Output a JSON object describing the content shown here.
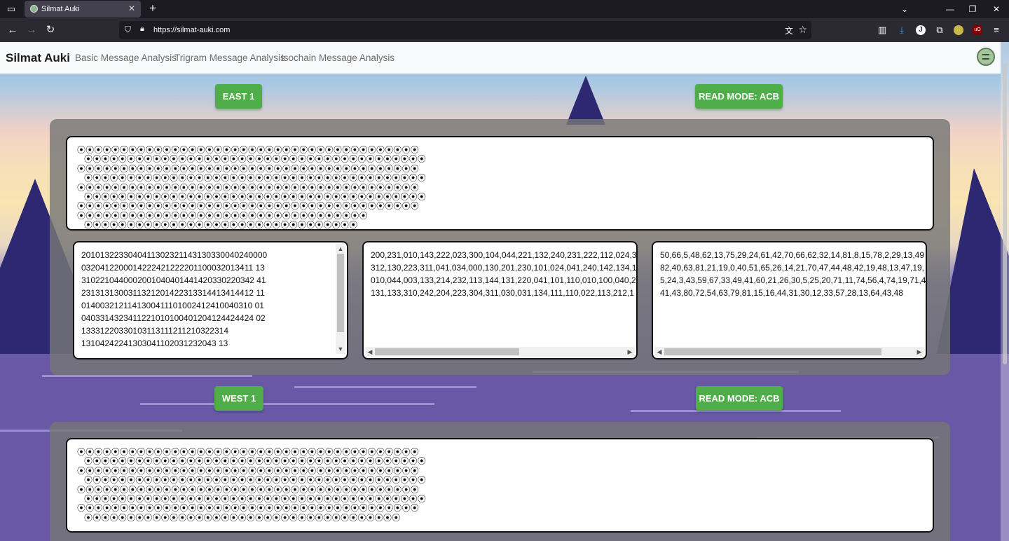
{
  "browser": {
    "tab_title": "Silmat Auki",
    "tab_close": "✕",
    "new_tab": "+",
    "url": "https://silmat-auki.com"
  },
  "site": {
    "brand": "Silmat Auki",
    "nav": [
      "Basic Message Analysis",
      "Trigram Message Analysis",
      "Isochain Message Analysis"
    ]
  },
  "sections": [
    {
      "name_button": "EAST 1",
      "read_mode_button": "READ MODE: ACB",
      "glyph_lines": [
        "⦿⦿⦿⦿⦿⦿⦿⦿⦿⦿⦿⦿⦿⦿⦿⦿⦿⦿⦿⦿⦿⦿⦿⦿⦿⦿⦿⦿⦿⦿⦿⦿⦿⦿⦿⦿⦿⦿⦿⦿",
        "⦿⦿⦿⦿⦿⦿⦿⦿⦿⦿⦿⦿⦿⦿⦿⦿⦿⦿⦿⦿⦿⦿⦿⦿⦿⦿⦿⦿⦿⦿⦿⦿⦿⦿⦿⦿⦿⦿⦿⦿",
        "⦿⦿⦿⦿⦿⦿⦿⦿⦿⦿⦿⦿⦿⦿⦿⦿⦿⦿⦿⦿⦿⦿⦿⦿⦿⦿⦿⦿⦿⦿⦿⦿⦿⦿⦿⦿⦿⦿⦿⦿",
        "⦿⦿⦿⦿⦿⦿⦿⦿⦿⦿⦿⦿⦿⦿⦿⦿⦿⦿⦿⦿⦿⦿⦿⦿⦿⦿⦿⦿⦿⦿⦿⦿⦿⦿⦿⦿⦿⦿⦿⦿",
        "⦿⦿⦿⦿⦿⦿⦿⦿⦿⦿⦿⦿⦿⦿⦿⦿⦿⦿⦿⦿⦿⦿⦿⦿⦿⦿⦿⦿⦿⦿⦿⦿⦿⦿⦿⦿⦿⦿⦿⦿",
        "⦿⦿⦿⦿⦿⦿⦿⦿⦿⦿⦿⦿⦿⦿⦿⦿⦿⦿⦿⦿⦿⦿⦿⦿⦿⦿⦿⦿⦿⦿⦿⦿⦿⦿⦿⦿⦿⦿⦿⦿",
        "⦿⦿⦿⦿⦿⦿⦿⦿⦿⦿⦿⦿⦿⦿⦿⦿⦿⦿⦿⦿⦿⦿⦿⦿⦿⦿⦿⦿⦿⦿⦿⦿⦿⦿⦿⦿⦿⦿⦿⦿",
        "⦿⦿⦿⦿⦿⦿⦿⦿⦿⦿⦿⦿⦿⦿⦿⦿⦿⦿⦿⦿⦿⦿⦿⦿⦿⦿⦿⦿⦿⦿⦿⦿⦿⦿",
        "⦿⦿⦿⦿⦿⦿⦿⦿⦿⦿⦿⦿⦿⦿⦿⦿⦿⦿⦿⦿⦿⦿⦿⦿⦿⦿⦿⦿⦿⦿⦿⦿"
      ],
      "base5_text": "2010132233040411302321143130330040240000\n0320412200014222421222201100032013411 13\n3102210440002001040401441420330220342 41\n2313131300311321201422313314413414412 11\n0140032121141300411101002412410040310 01\n0403314323411221010100401204124424424 02\n13331220330103113111211210322314\n13104242241303041102031232043 13",
      "trigram_text": "200,231,010,143,222,023,300,104,044,221,132,240,231,222,112,024,3\n312,130,223,311,041,034,000,130,201,230,101,024,041,240,142,134,1\n010,044,003,133,214,232,113,144,131,220,041,101,110,010,100,040,2\n131,133,310,242,204,223,304,311,030,031,134,111,110,022,113,212,1",
      "decimal_text": "50,66,5,48,62,13,75,29,24,61,42,70,66,62,32,14,81,8,15,78,2,29,13,49\n82,40,63,81,21,19,0,40,51,65,26,14,21,70,47,44,48,42,19,48,13,47,19,\n5,24,3,43,59,67,33,49,41,60,21,26,30,5,25,20,71,11,74,56,4,74,19,71,4\n41,43,80,72,54,63,79,81,15,16,44,31,30,12,33,57,28,13,64,43,48"
    },
    {
      "name_button": "WEST 1",
      "read_mode_button": "READ MODE: ACB",
      "glyph_lines": [
        "⦿⦿⦿⦿⦿⦿⦿⦿⦿⦿⦿⦿⦿⦿⦿⦿⦿⦿⦿⦿⦿⦿⦿⦿⦿⦿⦿⦿⦿⦿⦿⦿⦿⦿⦿⦿⦿⦿⦿⦿",
        "⦿⦿⦿⦿⦿⦿⦿⦿⦿⦿⦿⦿⦿⦿⦿⦿⦿⦿⦿⦿⦿⦿⦿⦿⦿⦿⦿⦿⦿⦿⦿⦿⦿⦿⦿⦿⦿⦿⦿⦿",
        "⦿⦿⦿⦿⦿⦿⦿⦿⦿⦿⦿⦿⦿⦿⦿⦿⦿⦿⦿⦿⦿⦿⦿⦿⦿⦿⦿⦿⦿⦿⦿⦿⦿⦿⦿⦿⦿⦿⦿⦿",
        "⦿⦿⦿⦿⦿⦿⦿⦿⦿⦿⦿⦿⦿⦿⦿⦿⦿⦿⦿⦿⦿⦿⦿⦿⦿⦿⦿⦿⦿⦿⦿⦿⦿⦿⦿⦿⦿⦿⦿⦿",
        "⦿⦿⦿⦿⦿⦿⦿⦿⦿⦿⦿⦿⦿⦿⦿⦿⦿⦿⦿⦿⦿⦿⦿⦿⦿⦿⦿⦿⦿⦿⦿⦿⦿⦿⦿⦿⦿⦿⦿⦿",
        "⦿⦿⦿⦿⦿⦿⦿⦿⦿⦿⦿⦿⦿⦿⦿⦿⦿⦿⦿⦿⦿⦿⦿⦿⦿⦿⦿⦿⦿⦿⦿⦿⦿⦿⦿⦿⦿⦿⦿⦿",
        "⦿⦿⦿⦿⦿⦿⦿⦿⦿⦿⦿⦿⦿⦿⦿⦿⦿⦿⦿⦿⦿⦿⦿⦿⦿⦿⦿⦿⦿⦿⦿⦿⦿⦿⦿⦿⦿⦿⦿⦿",
        "⦿⦿⦿⦿⦿⦿⦿⦿⦿⦿⦿⦿⦿⦿⦿⦿⦿⦿⦿⦿⦿⦿⦿⦿⦿⦿⦿⦿⦿⦿⦿⦿⦿⦿⦿⦿⦿"
      ]
    }
  ],
  "colors": {
    "button_green": "#4fae4a",
    "panel_gray": "#767676",
    "mountain": "#2e2872",
    "water": "#6858a6"
  },
  "icons": [
    "tab-list-icon",
    "back-icon",
    "forward-icon",
    "reload-icon",
    "shield-icon",
    "lock-icon",
    "translate-icon",
    "star-icon",
    "sidebar-icon",
    "download-icon",
    "extension-icon",
    "menu-icon"
  ]
}
